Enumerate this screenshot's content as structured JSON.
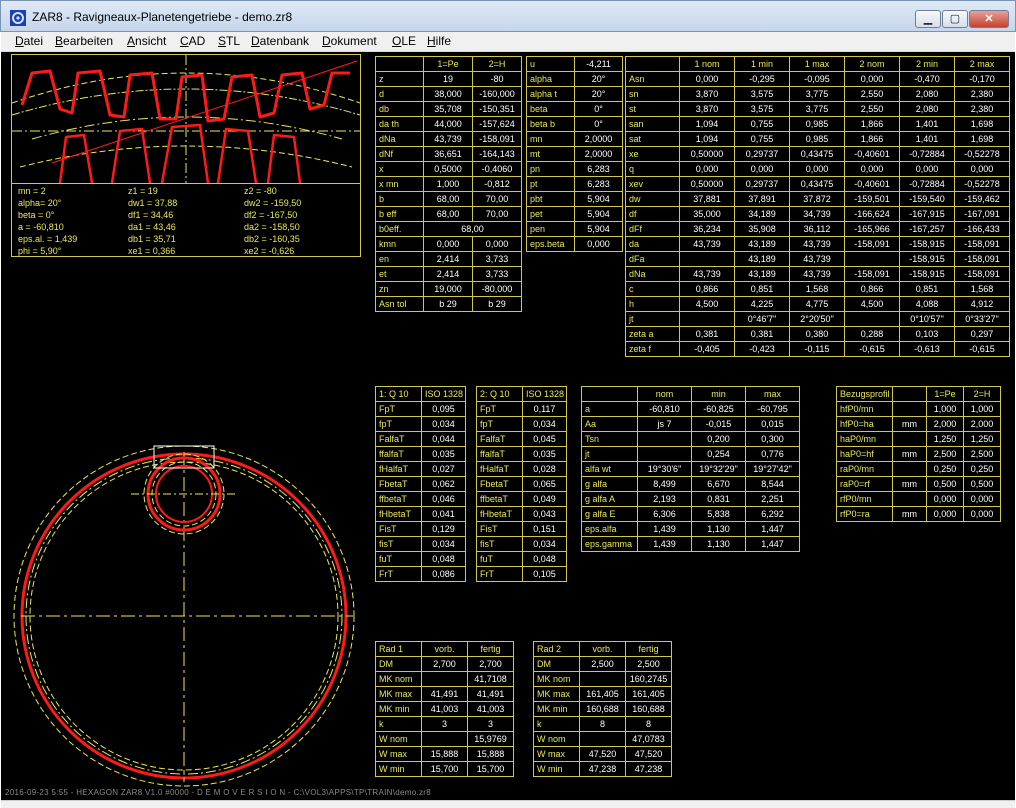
{
  "window": {
    "title": "ZAR8 - Ravigneaux-Planetengetriebe  -  demo.zr8",
    "min": "▁",
    "max": "▢",
    "close": "✕",
    "icon": "zar8-app-icon"
  },
  "menu": [
    {
      "u": "D",
      "rest": "atei"
    },
    {
      "u": "B",
      "rest": "earbeiten"
    },
    {
      "u": "A",
      "rest": "nsicht"
    },
    {
      "u": "C",
      "rest": "AD"
    },
    {
      "u": "S",
      "rest": "TL"
    },
    {
      "u": "D",
      "rest": "atenbank"
    },
    {
      "u": "D",
      "rest": "okument"
    },
    {
      "u": "O",
      "rest": "LE"
    },
    {
      "u": "H",
      "rest": "ilfe"
    }
  ],
  "params": [
    [
      "mn = 2",
      "z1 = 19",
      "z2 = -80"
    ],
    [
      "alpha= 20°",
      "dw1 = 37,88",
      "dw2 = -159,50"
    ],
    [
      "beta = 0°",
      "df1 = 34,46",
      "df2 = -167,50"
    ],
    [
      "a = -60,810",
      "da1 = 43,46",
      "da2 = -158,50"
    ],
    [
      "eps.al. = 1,439",
      "db1 = 35,71",
      "db2 = -160,35"
    ],
    [
      "phi = 5,90°",
      "xe1 = 0,366",
      "xe2 = -0,626"
    ]
  ],
  "table_gear": {
    "head": [
      "",
      "1=Pe",
      "2=H"
    ],
    "rows": [
      [
        "z",
        "19",
        "-80"
      ],
      [
        "d",
        "38,000",
        "-160,000"
      ],
      [
        "db",
        "35,708",
        "-150,351"
      ],
      [
        "da th",
        "44,000",
        "-157,624"
      ],
      [
        "dNa",
        "43,739",
        "-158,091"
      ],
      [
        "dNf",
        "36,651",
        "-164,143"
      ],
      [
        "x",
        "0,5000",
        "-0,4060"
      ],
      [
        "x  mn",
        "1,000",
        "-0,812"
      ],
      [
        "b",
        "68,00",
        "70,00"
      ],
      [
        "b eff",
        "68,00",
        "70,00"
      ],
      [
        "b0eff.",
        "68,00",
        null
      ],
      [
        "kmn",
        "0,000",
        "0,000"
      ],
      [
        "en",
        "2,414",
        "3,733"
      ],
      [
        "et",
        "2,414",
        "3,733"
      ],
      [
        "zn",
        "19,000",
        "-80,000"
      ],
      [
        "Asn tol",
        "b 29",
        "b 29"
      ]
    ]
  },
  "table_u": {
    "rows": [
      [
        "u",
        "-4,211"
      ],
      [
        "alpha",
        "20°"
      ],
      [
        "alpha t",
        "20°"
      ],
      [
        "beta",
        "0°"
      ],
      [
        "beta b",
        "0°"
      ],
      [
        "mn",
        "2,0000"
      ],
      [
        "mt",
        "2,0000"
      ],
      [
        "pn",
        "6,283"
      ],
      [
        "pt",
        "6,283"
      ],
      [
        "pbt",
        "5,904"
      ],
      [
        "pet",
        "5,904"
      ],
      [
        "pen",
        "5,904"
      ],
      [
        "eps.beta",
        "0,000"
      ]
    ]
  },
  "table_tol": {
    "head": [
      "",
      "1 nom",
      "1 min",
      "1 max",
      "2 nom",
      "2 min",
      "2 max"
    ],
    "rows": [
      [
        "Asn",
        "0,000",
        "-0,295",
        "-0,095",
        "0,000",
        "-0,470",
        "-0,170"
      ],
      [
        "sn",
        "3,870",
        "3,575",
        "3,775",
        "2,550",
        "2,080",
        "2,380"
      ],
      [
        "st",
        "3,870",
        "3,575",
        "3,775",
        "2,550",
        "2,080",
        "2,380"
      ],
      [
        "san",
        "1,094",
        "0,755",
        "0,985",
        "1,866",
        "1,401",
        "1,698"
      ],
      [
        "sat",
        "1,094",
        "0,755",
        "0,985",
        "1,866",
        "1,401",
        "1,698"
      ],
      [
        "xe",
        "0,50000",
        "0,29737",
        "0,43475",
        "-0,40601",
        "-0,72884",
        "-0,52278"
      ],
      [
        "q",
        "0,000",
        "0,000",
        "0,000",
        "0,000",
        "0,000",
        "0,000"
      ],
      [
        "xev",
        "0,50000",
        "0,29737",
        "0,43475",
        "-0,40601",
        "-0,72884",
        "-0,52278"
      ],
      [
        "dw",
        "37,881",
        "37,891",
        "37,872",
        "-159,501",
        "-159,540",
        "-159,462"
      ],
      [
        "df",
        "35,000",
        "34,189",
        "34,739",
        "-166,624",
        "-167,915",
        "-167,091"
      ],
      [
        "dFf",
        "36,234",
        "35,908",
        "36,112",
        "-165,966",
        "-167,257",
        "-166,433"
      ],
      [
        "da",
        "43,739",
        "43,189",
        "43,739",
        "-158,091",
        "-158,915",
        "-158,091"
      ],
      [
        "dFa",
        "",
        "43,189",
        "43,739",
        "",
        "-158,915",
        "-158,091"
      ],
      [
        "dNa",
        "43,739",
        "43,189",
        "43,739",
        "-158,091",
        "-158,915",
        "-158,091"
      ],
      [
        "c",
        "0,866",
        "0,851",
        "1,568",
        "0,866",
        "0,851",
        "1,568"
      ],
      [
        "h",
        "4,500",
        "4,225",
        "4,775",
        "4,500",
        "4,088",
        "4,912"
      ],
      [
        "jt",
        "",
        "0°46'7\"",
        "2°20'50\"",
        "",
        "0°10'57\"",
        "0°33'27\""
      ],
      [
        "zeta a",
        "0,381",
        "0,381",
        "0,380",
        "0,288",
        "0,103",
        "0,297"
      ],
      [
        "zeta f",
        "-0,405",
        "-0,423",
        "-0,115",
        "-0,615",
        "-0,613",
        "-0,615"
      ]
    ]
  },
  "table_q1": {
    "head": [
      "1: Q 10",
      "ISO 1328"
    ],
    "rows": [
      [
        "FpT",
        "0,095"
      ],
      [
        "fpT",
        "0,034"
      ],
      [
        "FalfaT",
        "0,044"
      ],
      [
        "ffalfaT",
        "0,035"
      ],
      [
        "fHalfaT",
        "0,027"
      ],
      [
        "FbetaT",
        "0,062"
      ],
      [
        "ffbetaT",
        "0,046"
      ],
      [
        "fHbetaT",
        "0,041"
      ],
      [
        "FisT",
        "0,129"
      ],
      [
        "fisT",
        "0,034"
      ],
      [
        "fuT",
        "0,048"
      ],
      [
        "FrT",
        "0,086"
      ]
    ]
  },
  "table_q2": {
    "head": [
      "2: Q 10",
      "ISO 1328"
    ],
    "rows": [
      [
        "FpT",
        "0,117"
      ],
      [
        "fpT",
        "0,034"
      ],
      [
        "FalfaT",
        "0,045"
      ],
      [
        "ffalfaT",
        "0,035"
      ],
      [
        "fHalfaT",
        "0,028"
      ],
      [
        "FbetaT",
        "0,065"
      ],
      [
        "ffbetaT",
        "0,049"
      ],
      [
        "fHbetaT",
        "0,043"
      ],
      [
        "FisT",
        "0,151"
      ],
      [
        "fisT",
        "0,034"
      ],
      [
        "fuT",
        "0,048"
      ],
      [
        "FrT",
        "0,105"
      ]
    ]
  },
  "table_center": {
    "head": [
      "",
      "nom",
      "min",
      "max"
    ],
    "rows": [
      [
        "a",
        "-60,810",
        "-60,825",
        "-60,795"
      ],
      [
        "Aa",
        "js 7",
        "-0,015",
        "0,015"
      ],
      [
        "Tsn",
        "",
        "0,200",
        "0,300"
      ],
      [
        "jt",
        "",
        "0,254",
        "0,776"
      ],
      [
        "alfa wt",
        "19°30'6\"",
        "19°32'29\"",
        "19°27'42\""
      ],
      [
        "g alfa",
        "8,499",
        "6,670",
        "8,544"
      ],
      [
        "g alfa A",
        "2,193",
        "0,831",
        "2,251"
      ],
      [
        "g alfa E",
        "6,306",
        "5,838",
        "6,292"
      ],
      [
        "eps.alfa",
        "1,439",
        "1,130",
        "1,447"
      ],
      [
        "eps.gamma",
        "1,439",
        "1,130",
        "1,447"
      ]
    ]
  },
  "table_bezug": {
    "head": [
      "Bezugsprofil",
      "",
      "1=Pe",
      "2=H"
    ],
    "rows": [
      [
        "hfP0/mn",
        "",
        "1,000",
        "1,000"
      ],
      [
        "hfP0=ha",
        "mm",
        "2,000",
        "2,000"
      ],
      [
        "haP0/mn",
        "",
        "1,250",
        "1,250"
      ],
      [
        "haP0=hf",
        "mm",
        "2,500",
        "2,500"
      ],
      [
        "raP0/mn",
        "",
        "0,250",
        "0,250"
      ],
      [
        "raP0=rf",
        "mm",
        "0,500",
        "0,500"
      ],
      [
        "rfP0/mn",
        "",
        "0,000",
        "0,000"
      ],
      [
        "rfP0=ra",
        "mm",
        "0,000",
        "0,000"
      ]
    ]
  },
  "table_rad1": {
    "head": [
      "Rad 1",
      "vorb.",
      "fertig"
    ],
    "rows": [
      [
        "DM",
        "2,700",
        "2,700"
      ],
      [
        "MK nom",
        "",
        "41,7108"
      ],
      [
        "MK max",
        "41,491",
        "41,491"
      ],
      [
        "MK min",
        "41,003",
        "41,003"
      ],
      [
        "k",
        "3",
        "3"
      ],
      [
        "W nom",
        "",
        "15,9769"
      ],
      [
        "W max",
        "15,888",
        "15,888"
      ],
      [
        "W min",
        "15,700",
        "15,700"
      ]
    ]
  },
  "table_rad2": {
    "head": [
      "Rad 2",
      "vorb.",
      "fertig"
    ],
    "rows": [
      [
        "DM",
        "2,500",
        "2,500"
      ],
      [
        "MK nom",
        "",
        "160,2745"
      ],
      [
        "MK max",
        "161,405",
        "161,405"
      ],
      [
        "MK min",
        "160,688",
        "160,688"
      ],
      [
        "k",
        "8",
        "8"
      ],
      [
        "W nom",
        "",
        "47,0783"
      ],
      [
        "W max",
        "47,520",
        "47,520"
      ],
      [
        "W min",
        "47,238",
        "47,238"
      ]
    ]
  },
  "footer": "2016-09-23 5:55 - HEXAGON ZAR8 V1.0 #0000 - D E M O V E R S I O N - C:\\VOL3\\APPS\\TP\\TRAIN\\demo.zr8",
  "colors": {
    "background": "#000000",
    "grid": "#d0c84c",
    "label": "#e9e95a",
    "value": "#ffffff",
    "gear": "#ff1a1a",
    "dash": "#e9e95a"
  }
}
